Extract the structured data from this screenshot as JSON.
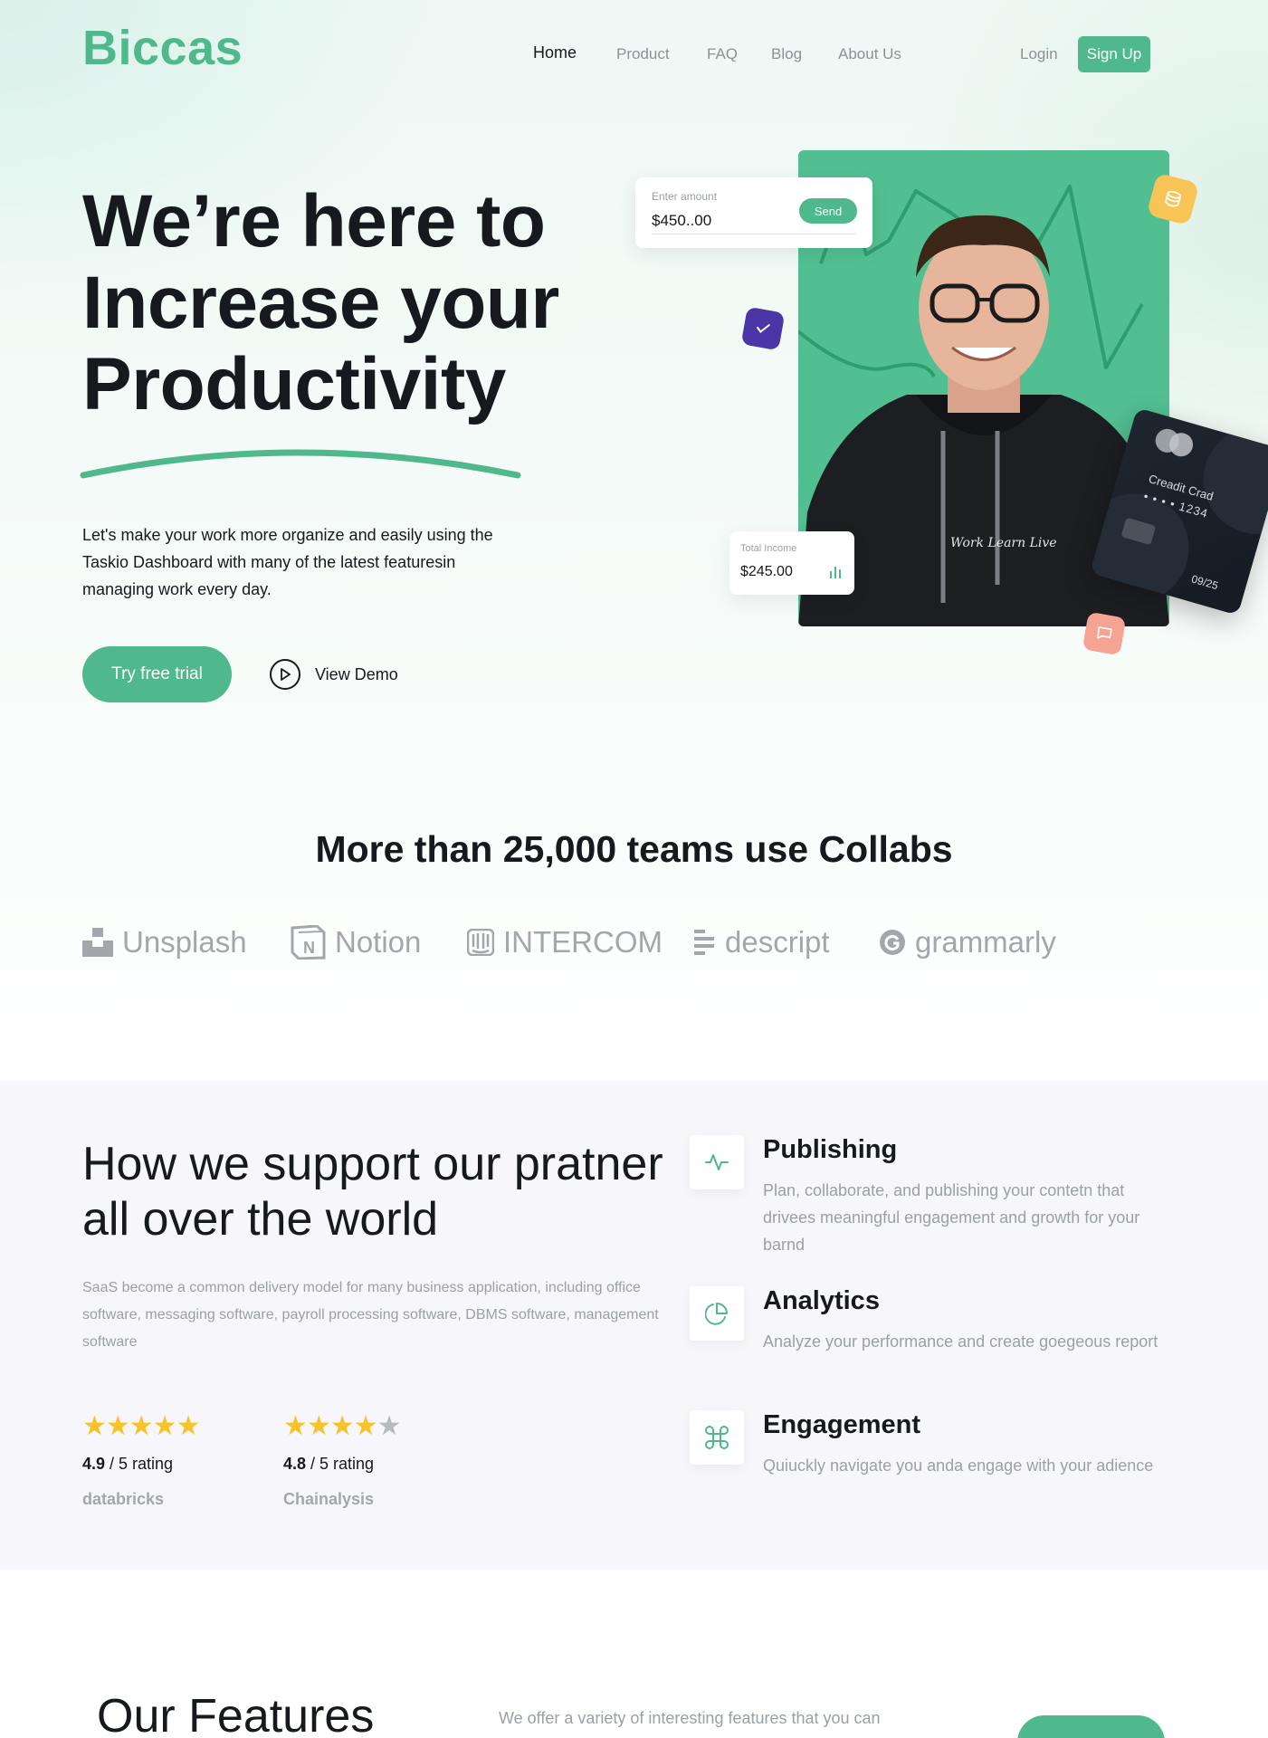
{
  "brand": {
    "logo": "Biccas",
    "accent": "#4fb88d"
  },
  "nav": {
    "items": [
      "Home",
      "Product",
      "FAQ",
      "Blog",
      "About Us"
    ],
    "active": "Home",
    "login": "Login",
    "signup": "Sign Up"
  },
  "hero": {
    "title_lines": [
      "We’re here to",
      "Increase your",
      "Productivity"
    ],
    "description": "Let's make your work more organize and easily using the Taskio Dashboard with many of the latest featuresin managing work every day.",
    "cta_primary": "Try free trial",
    "cta_secondary": "View Demo",
    "amount_card": {
      "label": "Enter amount",
      "value": "$450..00",
      "button": "Send"
    },
    "income_card": {
      "label": "Total Income",
      "value": "$245.00"
    },
    "credit_card": {
      "name": "Creadit Crad",
      "number": "• • • •   1234",
      "expiry": "09/25"
    },
    "hoodie_text": "Work Learn Live"
  },
  "teams": {
    "title": "More than 25,000 teams use Collabs",
    "brands": [
      "Unsplash",
      "Notion",
      "INTERCOM",
      "descript",
      "grammarly"
    ]
  },
  "support": {
    "title": "How we support our pratner all over the world",
    "description": "SaaS become a common delivery model for many business application, including office software, messaging software, payroll processing software, DBMS software, management software",
    "ratings": [
      {
        "score": "4.9",
        "suffix": " / 5 rating",
        "brand": "databricks",
        "stars": 5
      },
      {
        "score": "4.8",
        "suffix": " / 5 rating",
        "brand": "Chainalysis",
        "stars": 4
      }
    ],
    "features": [
      {
        "icon": "activity-icon",
        "title": "Publishing",
        "desc": "Plan, collaborate, and publishing your contetn that drivees meaningful engagement and growth for your barnd"
      },
      {
        "icon": "pie-chart-icon",
        "title": "Analytics",
        "desc": "Analyze your performance and create goegeous report"
      },
      {
        "icon": "command-icon",
        "title": "Engagement",
        "desc": "Quiuckly navigate you anda engage with your adience"
      }
    ]
  },
  "features_section": {
    "title": "Our Features",
    "description": "We offer a variety of interesting features that you can"
  }
}
